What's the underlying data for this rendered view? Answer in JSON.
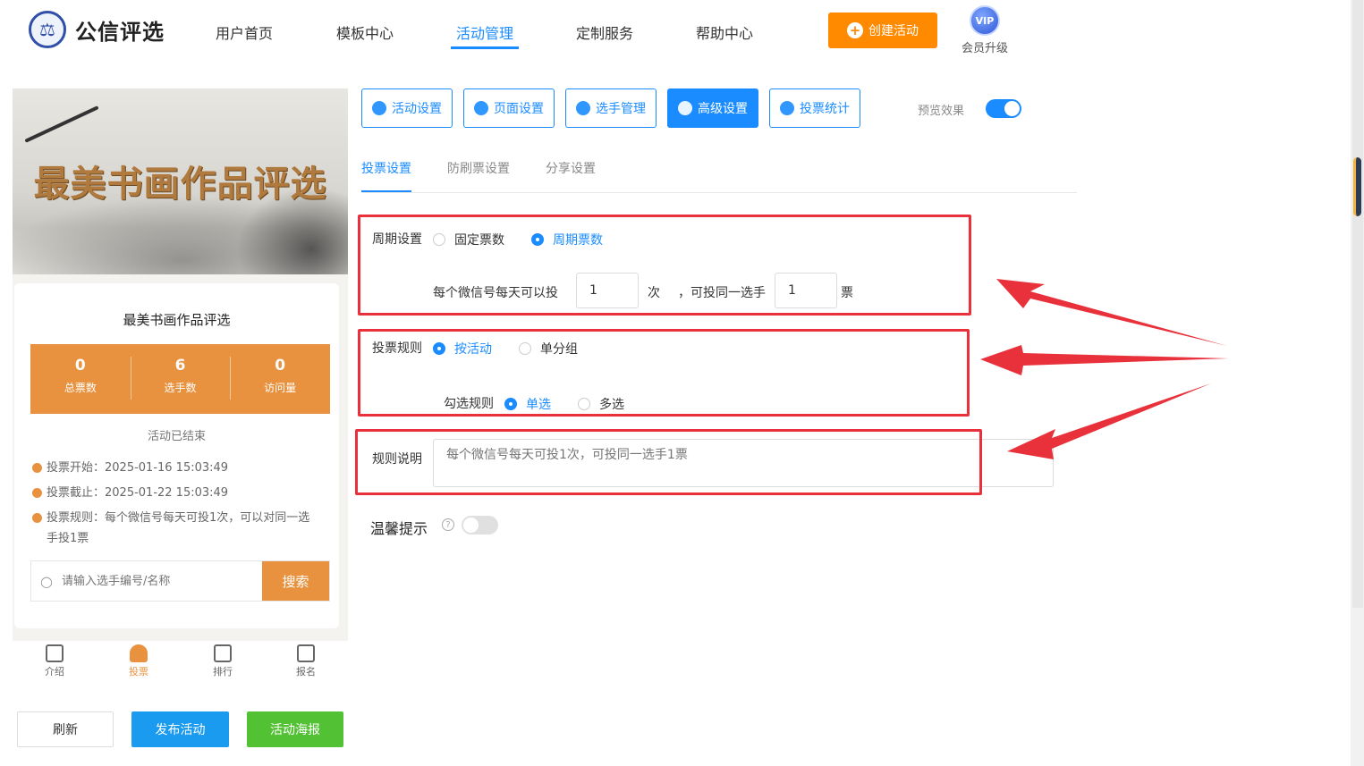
{
  "brand": {
    "name": "公信评选"
  },
  "nav": {
    "items": [
      "用户首页",
      "模板中心",
      "活动管理",
      "定制服务",
      "帮助中心"
    ],
    "active": "活动管理",
    "create_label": "创建活动",
    "vip_badge": "VIP",
    "vip_label": "会员升级"
  },
  "preview": {
    "banner_title": "最美书画作品评选",
    "title": "最美书画作品评选",
    "stats": [
      {
        "value": "0",
        "label": "总票数"
      },
      {
        "value": "6",
        "label": "选手数"
      },
      {
        "value": "0",
        "label": "访问量"
      }
    ],
    "status": "活动已结束",
    "info": [
      "投票开始：2025-01-16 15:03:49",
      "投票截止：2025-01-22 15:03:49",
      "投票规则：每个微信号每天可投1次，可以对同一选手投1票"
    ],
    "search_placeholder": "请输入选手编号/名称",
    "search_button": "搜索",
    "bottom_tabs": [
      "介绍",
      "投票",
      "排行",
      "报名"
    ],
    "active_tab": "投票"
  },
  "actions": {
    "refresh": "刷新",
    "publish": "发布活动",
    "poster": "活动海报"
  },
  "toolbar": {
    "buttons": [
      "活动设置",
      "页面设置",
      "选手管理",
      "高级设置",
      "投票统计"
    ],
    "active": "高级设置",
    "preview_label": "预览效果",
    "preview_on": true
  },
  "subtabs": {
    "items": [
      "投票设置",
      "防刷票设置",
      "分享设置"
    ],
    "active": "投票设置"
  },
  "form": {
    "period_label": "周期设置",
    "period_options": [
      "固定票数",
      "周期票数"
    ],
    "period_selected": "周期票数",
    "per_day_text": "每个微信号每天可以投",
    "times_value": "1",
    "times_unit": "次",
    "same_player_text": "，可投同一选手",
    "votes_value": "1",
    "votes_unit": "票",
    "rule_label": "投票规则",
    "rule_options": [
      "按活动",
      "单分组"
    ],
    "rule_selected": "按活动",
    "check_label": "勾选规则",
    "check_options": [
      "单选",
      "多选"
    ],
    "check_selected": "单选",
    "desc_label": "规则说明",
    "desc_placeholder": "每个微信号每天可投1次，可投同一选手1票",
    "warm_label": "温馨提示",
    "warm_on": false
  },
  "colors": {
    "accent": "#1a8cff",
    "orange": "#e8923f",
    "annotation": "#e8313a",
    "create": "#ff8a00"
  }
}
